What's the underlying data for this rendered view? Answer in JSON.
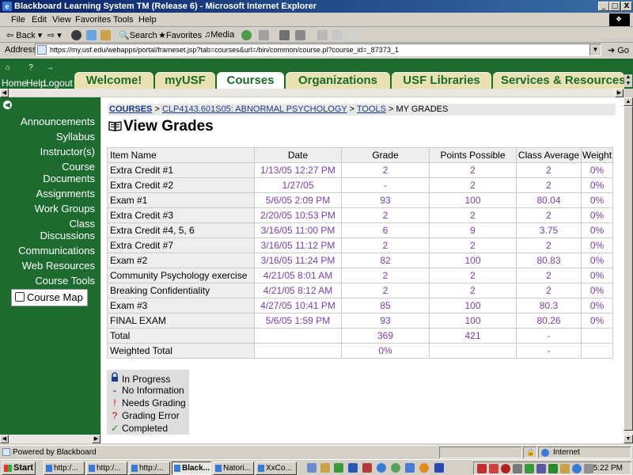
{
  "window": {
    "title": "Blackboard Learning System TM (Release 6) - Microsoft Internet Explorer",
    "controls": [
      "_",
      "&#x25A1;",
      "X"
    ]
  },
  "menu": [
    "File",
    "Edit",
    "View",
    "Favorites",
    "Tools",
    "Help"
  ],
  "toolbar": {
    "back": "Back",
    "search": "Search",
    "favorites": "Favorites",
    "media": "Media"
  },
  "address": {
    "label": "Address",
    "url": "https://my.usf.edu/webapps/portal/frameset.jsp?tab=courses&url=/bin/common/course.pl?course_id=_87373_1",
    "go": "Go"
  },
  "bb_header": {
    "nav": [
      "Home",
      "Help",
      "Logout"
    ],
    "tabs": [
      {
        "label": "Welcome!",
        "active": false
      },
      {
        "label": "myUSF",
        "active": false
      },
      {
        "label": "Courses",
        "active": true
      },
      {
        "label": "Organizations",
        "active": false
      },
      {
        "label": "USF Libraries",
        "active": false
      },
      {
        "label": "Services & Resources",
        "active": false
      }
    ]
  },
  "sidebar": {
    "items": [
      "Announcements",
      "Syllabus",
      "Instructor(s)",
      "Course Documents",
      "Assignments",
      "Work Groups",
      "Class Discussions",
      "Communications",
      "Web Resources",
      "Course Tools"
    ],
    "course_map": "Course Map"
  },
  "breadcrumb": {
    "courses": "COURSES",
    "course": "CLP4143.601S05: ABNORMAL PSYCHOLOGY",
    "tools": "TOOLS",
    "current": "MY GRADES",
    "sep": " > "
  },
  "page_title": "View Grades",
  "grades": {
    "headers": [
      "Item Name",
      "Date",
      "Grade",
      "Points Possible",
      "Class Average",
      "Weight"
    ],
    "rows": [
      [
        "Extra Credit #1",
        "1/13/05 12:27 PM",
        "2",
        "2",
        "2",
        "0%"
      ],
      [
        "Extra Credit #2",
        "1/27/05",
        "-",
        "2",
        "2",
        "0%"
      ],
      [
        "Exam #1",
        "5/6/05 2:09 PM",
        "93",
        "100",
        "80.04",
        "0%"
      ],
      [
        "Extra Credit #3",
        "2/20/05 10:53 PM",
        "2",
        "2",
        "2",
        "0%"
      ],
      [
        "Extra Credit #4, 5, 6",
        "3/16/05 11:00 PM",
        "6",
        "9",
        "3.75",
        "0%"
      ],
      [
        "Extra Credit #7",
        "3/16/05 11:12 PM",
        "2",
        "2",
        "2",
        "0%"
      ],
      [
        "Exam #2",
        "3/16/05 11:24 PM",
        "82",
        "100",
        "80.83",
        "0%"
      ],
      [
        "Community Psychology exercise",
        "4/21/05 8:01 AM",
        "2",
        "2",
        "2",
        "0%"
      ],
      [
        "Breaking Confidentiality",
        "4/21/05 8:12 AM",
        "2",
        "2",
        "2",
        "0%"
      ],
      [
        "Exam #3",
        "4/27/05 10:41 PM",
        "85",
        "100",
        "80.3",
        "0%"
      ],
      [
        "FINAL EXAM",
        "5/6/05 1:59 PM",
        "93",
        "100",
        "80.26",
        "0%"
      ],
      [
        "Total",
        "",
        "369",
        "421",
        "-",
        ""
      ],
      [
        "Weighted Total",
        "",
        "0%",
        "",
        "-",
        ""
      ]
    ]
  },
  "legend": [
    {
      "symbol": "",
      "label": "In Progress",
      "icon": "lock-icon"
    },
    {
      "symbol": "-",
      "label": "No Information"
    },
    {
      "symbol": "!",
      "label": "Needs Grading"
    },
    {
      "symbol": "?",
      "label": "Grading Error"
    },
    {
      "symbol": "✓",
      "label": "Completed"
    }
  ],
  "status": {
    "text": "Powered by Blackboard",
    "zone": "Internet"
  },
  "taskbar": {
    "start": "Start",
    "tasks": [
      {
        "label": "http:/...",
        "active": false
      },
      {
        "label": "http:/...",
        "active": false
      },
      {
        "label": "http:/...",
        "active": false
      },
      {
        "label": "Black...",
        "active": true
      },
      {
        "label": "Natori...",
        "active": false
      },
      {
        "label": "XxCo...",
        "active": false
      }
    ],
    "clock": "5:22 PM"
  },
  "colors": {
    "bb_green": "#1e6b30",
    "tab_bg": "#e8e2b2",
    "grade_value": "#7a3fa8",
    "link": "#1a3c8a"
  }
}
